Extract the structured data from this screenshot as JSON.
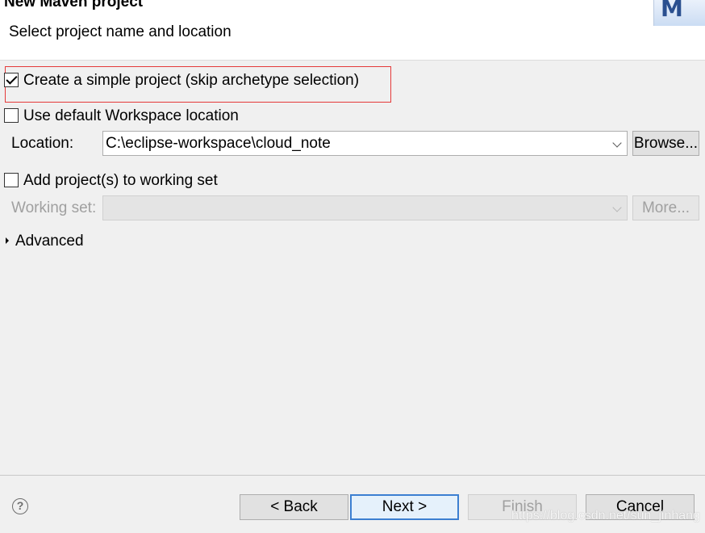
{
  "header": {
    "title": "New Maven project",
    "subtitle": "Select project name and location",
    "logo_letter": "M"
  },
  "options": {
    "simple_project": {
      "label": "Create a simple project (skip archetype selection)",
      "checked": true
    },
    "default_workspace": {
      "label": "Use default Workspace location",
      "checked": false
    },
    "location": {
      "label": "Location:",
      "value": "C:\\eclipse-workspace\\cloud_note",
      "browse_label": "Browse..."
    },
    "working_set_check": {
      "label": "Add project(s) to working set",
      "checked": false
    },
    "working_set": {
      "label": "Working set:",
      "value": "",
      "more_label": "More..."
    },
    "advanced_label": "Advanced"
  },
  "footer": {
    "help_symbol": "?",
    "back_label": "< Back",
    "next_label": "Next >",
    "finish_label": "Finish",
    "cancel_label": "Cancel"
  },
  "watermark": "https://blog.csdn.net/sun_jinhang",
  "colors": {
    "annotation": "#e53a3a",
    "focus": "#3c7fd1",
    "body": "#f0f0f0"
  }
}
